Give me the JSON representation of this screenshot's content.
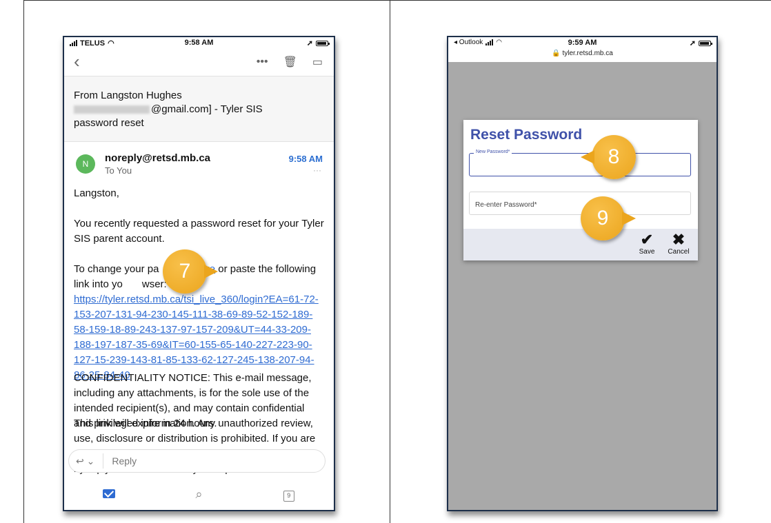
{
  "left_phone": {
    "status": {
      "carrier": "TELUS",
      "time": "9:58 AM"
    },
    "subject_line1": "From Langston Hughes",
    "subject_line2": "@gmail.com] - Tyler SIS",
    "subject_line3": "password reset",
    "sender": {
      "avatar_letter": "N",
      "name": "noreply@retsd.mb.ca",
      "to": "To You",
      "time": "9:58 AM",
      "more": "···"
    },
    "body": {
      "greeting": "Langston,",
      "para1": "You recently requested a password reset for your Tyler SIS parent account.",
      "para2_prefix": "To change your pa",
      "para2_mid": "k ",
      "link_here": "here",
      "para2_suffix": " or paste the following link into yo",
      "para2_end": "wser:",
      "long_link": "https://tyler.retsd.mb.ca/tsi_live_360/login?EA=61-72-153-207-131-94-230-145-111-38-69-89-52-152-189-58-159-18-89-243-137-97-157-209&UT=44-33-209-188-197-187-35-69&IT=60-155-65-140-227-223-90-127-15-239-143-81-85-133-62-127-245-138-207-94-86-25-84-40",
      "expire": "This link will expire in 24 hours.",
      "notice": "CONFIDENTIALITY NOTICE: This e-mail message, including any attachments, is for the sole use of the intended recipient(s), and may contain confidential and privileged information. Any unauthorized review, use, disclosure or distribution is prohibited. If you are not the intended recipient, please contact the sender by reply e-mail and destroy all copies of the"
    },
    "reply_label": "Reply",
    "calendar_day": "9"
  },
  "right_phone": {
    "status": {
      "back_app": "◂ Outlook",
      "time": "9:59 AM"
    },
    "url": "tyler.retsd.mb.ca",
    "dialog": {
      "title": "Reset Password",
      "new_password_label": "New Password*",
      "reenter_placeholder": "Re-enter Password*",
      "save_label": "Save",
      "cancel_label": "Cancel"
    }
  },
  "callouts": {
    "step7": "7",
    "step8": "8",
    "step9": "9"
  },
  "colors": {
    "accent": "#3f51a9",
    "link": "#2e6bd2",
    "callout": "#f0ad2a",
    "avatar": "#5cb85c"
  }
}
